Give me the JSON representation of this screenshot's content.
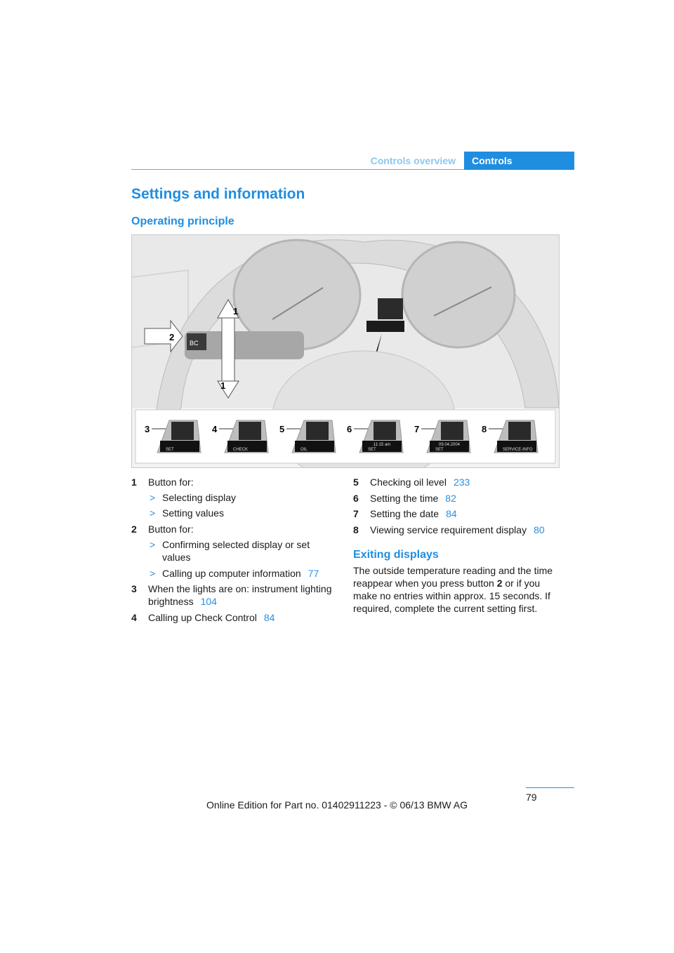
{
  "header": {
    "section": "Controls overview",
    "tab": "Controls"
  },
  "title": "Settings and information",
  "subtitle": "Operating principle",
  "figure": {
    "callouts": [
      "1",
      "2",
      "1"
    ],
    "controls": [
      "3",
      "4",
      "5",
      "6",
      "7",
      "8"
    ],
    "displays": [
      {
        "line1": "",
        "line2": "SET"
      },
      {
        "line1": "",
        "line2": "CHECK"
      },
      {
        "line1": "",
        "line2": "OIL"
      },
      {
        "line1": "11:15 am",
        "line2": "SET"
      },
      {
        "line1": "09.04.2004",
        "line2": "SET"
      },
      {
        "line1": "",
        "line2": "SERVICE-INFO"
      }
    ],
    "stalk_label": "BC"
  },
  "left_list": [
    {
      "n": "1",
      "text": "Button for:",
      "bullets": [
        "Selecting display",
        "Setting values"
      ]
    },
    {
      "n": "2",
      "text": "Button for:",
      "bullets": [
        "Confirming selected display or set values",
        "Calling up computer information"
      ],
      "bullet_ref": "77"
    },
    {
      "n": "3",
      "text": "When the lights are on: instrument lighting brightness",
      "ref": "104"
    },
    {
      "n": "4",
      "text": "Calling up Check Control",
      "ref": "84"
    }
  ],
  "right_list": [
    {
      "n": "5",
      "text": "Checking oil level",
      "ref": "233"
    },
    {
      "n": "6",
      "text": "Setting the time",
      "ref": "82"
    },
    {
      "n": "7",
      "text": "Setting the date",
      "ref": "84"
    },
    {
      "n": "8",
      "text": "Viewing service requirement display",
      "ref": "80"
    }
  ],
  "exiting": {
    "heading": "Exiting displays",
    "p1": "The outside temperature reading and the time reappear when you press button ",
    "bold": "2",
    "p2": " or if you make no entries within approx. 15 seconds. If required, complete the current setting first."
  },
  "bullet_glyph": ">",
  "page_number": "79",
  "footer": "Online Edition for Part no. 01402911223 - © 06/13 BMW AG",
  "colors": {
    "accent": "#1f8ee0"
  }
}
